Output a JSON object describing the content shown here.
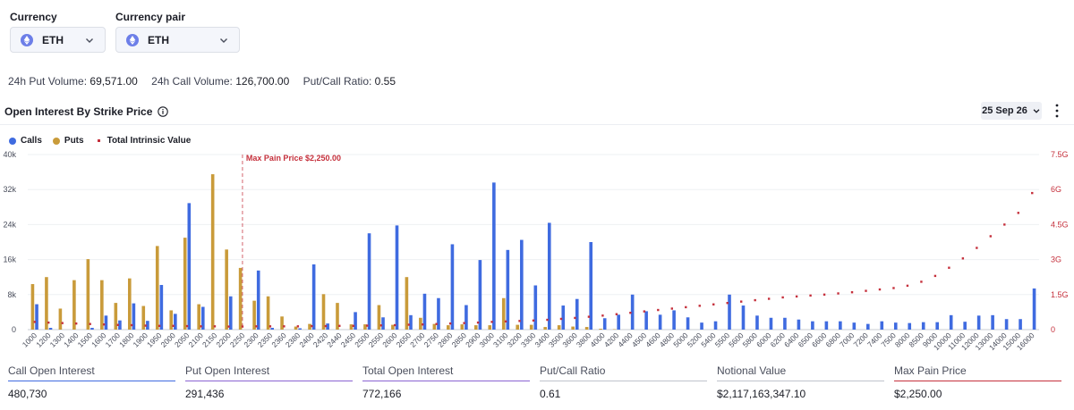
{
  "controls": {
    "currency_label": "Currency",
    "currency_value": "ETH",
    "pair_label": "Currency pair",
    "pair_value": "ETH"
  },
  "stats": {
    "put_volume_label": "24h Put Volume:",
    "put_volume_value": "69,571.00",
    "call_volume_label": "24h Call Volume:",
    "call_volume_value": "126,700.00",
    "ratio_label": "Put/Call Ratio:",
    "ratio_value": "0.55"
  },
  "section": {
    "title": "Open Interest By Strike Price",
    "date": "25 Sep 26"
  },
  "colors": {
    "calls": "#3f6be0",
    "puts": "#c99b3a",
    "intrinsic": "#c5303c",
    "call_line": "#3f6be0",
    "put_line": "#8a63d2",
    "total_line": "#8a63d2",
    "ratio_line": "#bfc3cc",
    "notional_line": "#bfc3cc",
    "maxpain_line": "#c5303c"
  },
  "chart_data": {
    "type": "bar",
    "legend": [
      "Calls",
      "Puts",
      "Total Intrinsic Value"
    ],
    "legend_position": "top-left",
    "max_pain_label": "Max Pain Price $2,250.00",
    "max_pain_strike": "2250",
    "y_left_ticks": [
      "0",
      "8k",
      "16k",
      "24k",
      "32k",
      "40k"
    ],
    "ylim_left": [
      0,
      40000
    ],
    "y_right_ticks": [
      "0",
      "1.5G",
      "3G",
      "4.5G",
      "6G",
      "7.5G"
    ],
    "ylim_right": [
      0,
      7.5
    ],
    "categories": [
      "1000",
      "1200",
      "1300",
      "1400",
      "1500",
      "1600",
      "1700",
      "1800",
      "1900",
      "1950",
      "2000",
      "2050",
      "2100",
      "2150",
      "2200",
      "2250",
      "2300",
      "2350",
      "2360",
      "2380",
      "2400",
      "2420",
      "2440",
      "2450",
      "2500",
      "2550",
      "2600",
      "2650",
      "2700",
      "2750",
      "2800",
      "2850",
      "2900",
      "3000",
      "3100",
      "3200",
      "3300",
      "3400",
      "3500",
      "3600",
      "3800",
      "4000",
      "4200",
      "4400",
      "4500",
      "4600",
      "4800",
      "5000",
      "5200",
      "5400",
      "5500",
      "5600",
      "5800",
      "6000",
      "6200",
      "6400",
      "6500",
      "6600",
      "6800",
      "7000",
      "7200",
      "7400",
      "7500",
      "8000",
      "8500",
      "9000",
      "10000",
      "11000",
      "12000",
      "13000",
      "14000",
      "15000",
      "16000"
    ],
    "series": [
      {
        "name": "Calls",
        "values": [
          5800,
          400,
          0,
          0,
          400,
          3200,
          2100,
          6000,
          2000,
          10200,
          3600,
          28900,
          5200,
          0,
          7600,
          0,
          13500,
          400,
          0,
          300,
          14900,
          1400,
          0,
          4000,
          22000,
          2800,
          23800,
          3300,
          8200,
          7200,
          19500,
          5600,
          15900,
          33600,
          18200,
          20500,
          10100,
          24400,
          5500,
          7000,
          20000,
          2600,
          3400,
          8000,
          4200,
          3400,
          4400,
          2800,
          1600,
          1900,
          8000,
          5500,
          3200,
          2700,
          2700,
          2300,
          1900,
          1900,
          1900,
          1600,
          1300,
          1900,
          1600,
          1500,
          1700,
          1700,
          3300,
          1800,
          3200,
          3300,
          2400,
          2400,
          9400
        ]
      },
      {
        "name": "Puts",
        "values": [
          10400,
          12000,
          4800,
          11300,
          16100,
          11300,
          6100,
          11700,
          5400,
          19100,
          4400,
          21000,
          5800,
          35500,
          18300,
          14100,
          6600,
          7600,
          3000,
          700,
          1300,
          8100,
          6100,
          1200,
          1200,
          5600,
          1100,
          12000,
          2700,
          1300,
          1000,
          1200,
          1000,
          1000,
          7200,
          1100,
          1100,
          600,
          1000,
          700,
          600,
          200,
          100,
          0,
          0,
          0,
          0,
          0,
          0,
          0,
          0,
          0,
          0,
          0,
          0,
          0,
          0,
          0,
          0,
          0,
          0,
          0,
          0,
          0,
          0,
          0,
          0,
          0,
          0,
          0,
          0,
          0,
          0
        ]
      },
      {
        "name": "Total Intrinsic Value",
        "values": [
          0.33,
          0.3,
          0.28,
          0.26,
          0.24,
          0.22,
          0.2,
          0.19,
          0.17,
          0.16,
          0.16,
          0.15,
          0.14,
          0.14,
          0.13,
          0.13,
          0.14,
          0.14,
          0.14,
          0.14,
          0.15,
          0.15,
          0.16,
          0.16,
          0.17,
          0.18,
          0.19,
          0.21,
          0.22,
          0.24,
          0.26,
          0.28,
          0.3,
          0.33,
          0.35,
          0.37,
          0.39,
          0.42,
          0.46,
          0.5,
          0.55,
          0.6,
          0.66,
          0.72,
          0.78,
          0.84,
          0.9,
          0.96,
          1.02,
          1.08,
          1.14,
          1.2,
          1.26,
          1.32,
          1.38,
          1.42,
          1.46,
          1.5,
          1.55,
          1.6,
          1.66,
          1.72,
          1.78,
          1.88,
          2.05,
          2.3,
          2.65,
          3.05,
          3.5,
          4.0,
          4.5,
          5.0,
          5.85
        ]
      }
    ]
  },
  "footer": [
    {
      "label": "Call Open Interest",
      "value": "480,730"
    },
    {
      "label": "Put Open Interest",
      "value": "291,436"
    },
    {
      "label": "Total Open Interest",
      "value": "772,166"
    },
    {
      "label": "Put/Call Ratio",
      "value": "0.61"
    },
    {
      "label": "Notional Value",
      "value": "$2,117,163,347.10"
    },
    {
      "label": "Max Pain Price",
      "value": "$2,250.00"
    }
  ]
}
